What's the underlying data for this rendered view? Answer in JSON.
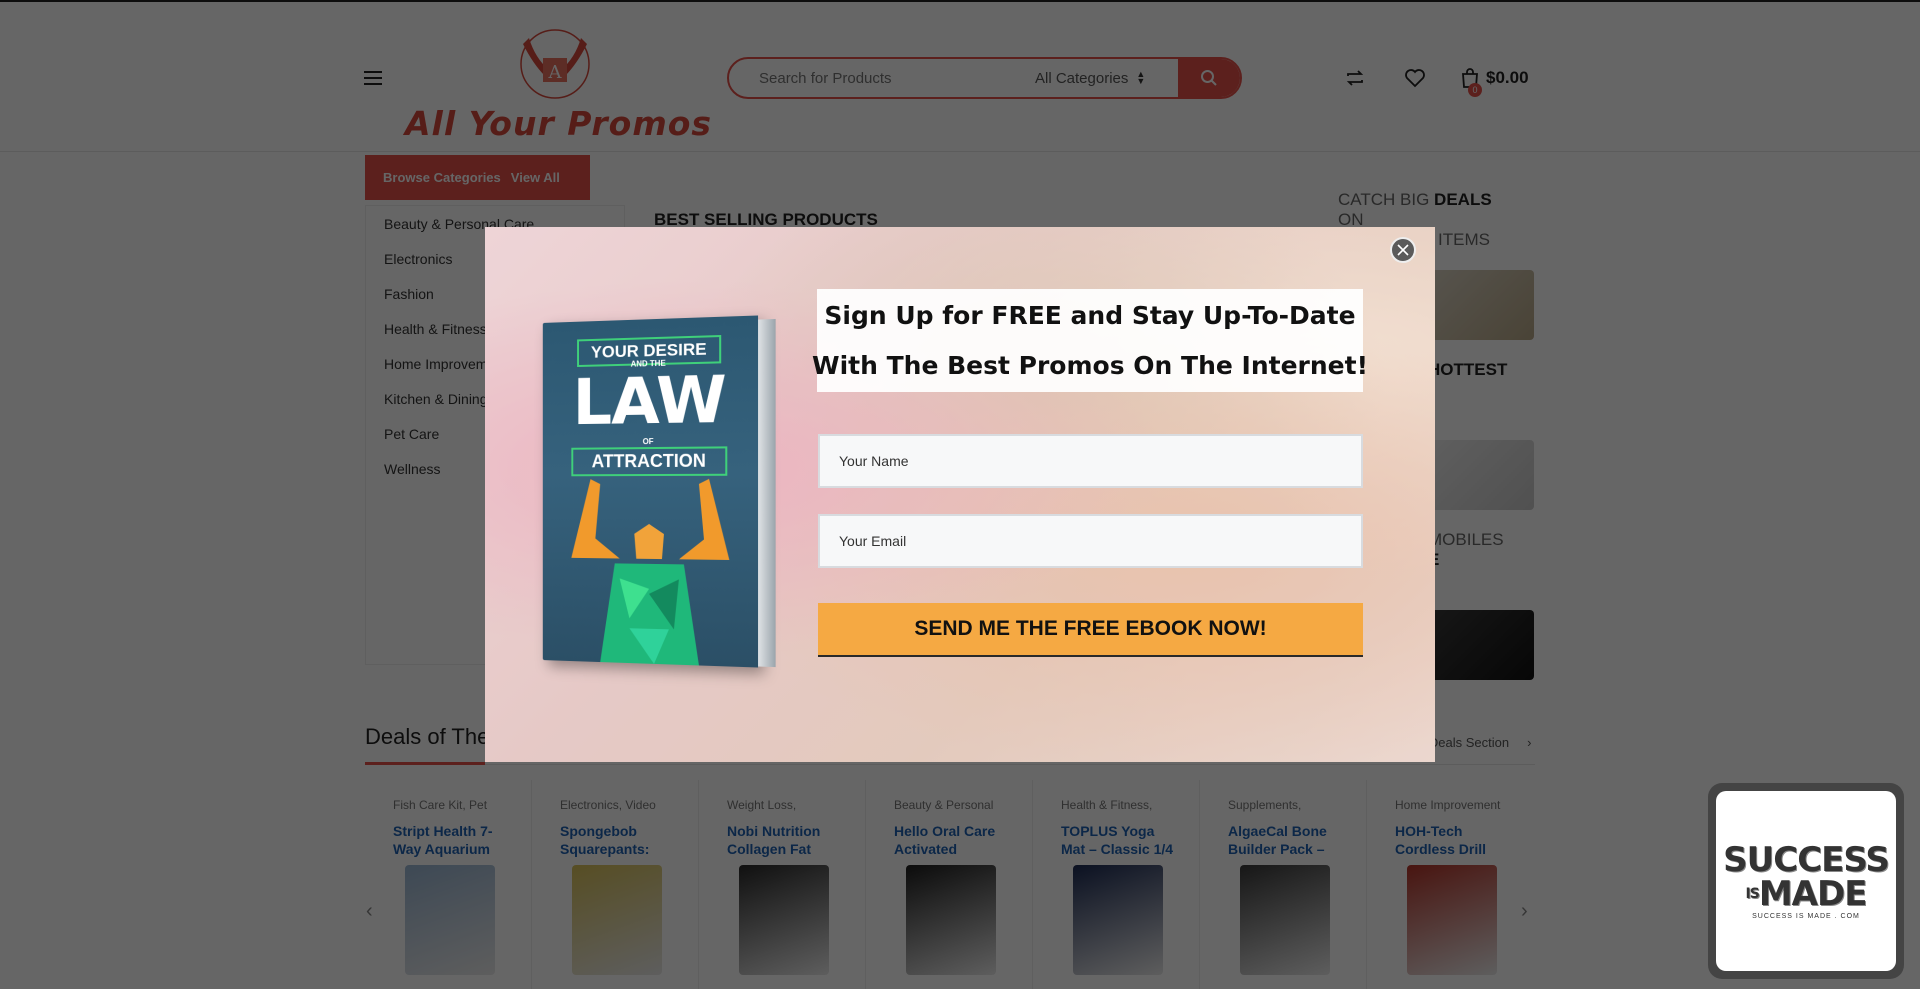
{
  "header": {
    "logo_text": "All Your Promos",
    "logo_letter": "A",
    "search_placeholder": "Search for Products",
    "category_select": "All Categories",
    "cart_count": "0",
    "cart_total": "$0.00"
  },
  "sidebar": {
    "browse_label": "Browse Categories",
    "view_all": "View All",
    "categories": [
      "Beauty & Personal Care",
      "Electronics",
      "Fashion",
      "Health & Fitness",
      "Home Improvement",
      "Kitchen & Dining",
      "Pet Care",
      "Wellness"
    ]
  },
  "main": {
    "best_selling": "BEST SELLING PRODUCTS"
  },
  "side_promos": [
    {
      "line1": "CATCH BIG",
      "bold": "DEALS",
      "line2": "ON",
      "line3": "ITEMS"
    },
    {
      "line1": "",
      "bold": "HOTTEST",
      "line2": "",
      "line3": ""
    },
    {
      "line1": "MOBILES",
      "bold": "E",
      "line2": "",
      "line3": ""
    }
  ],
  "deals": {
    "title": "Deals of The Day",
    "link": "View All Deals Section",
    "products": [
      {
        "category": "Fish Care Kit, Pet",
        "name": "Stript Health 7-Way Aquarium",
        "color": "#9ab6d3"
      },
      {
        "category": "Electronics, Video",
        "name": "Spongebob Squarepants:",
        "color": "#d9c25a"
      },
      {
        "category": "Weight Loss,",
        "name": "Nobi Nutrition Collagen Fat",
        "color": "#2a2a2a"
      },
      {
        "category": "Beauty & Personal",
        "name": "Hello Oral Care Activated",
        "color": "#1e1e1e"
      },
      {
        "category": "Health & Fitness,",
        "name": "TOPLUS Yoga Mat – Classic 1/4",
        "color": "#1d2c55"
      },
      {
        "category": "Supplements,",
        "name": "AlgaeCal Bone Builder Pack –",
        "color": "#3a3a3a"
      },
      {
        "category": "Home Improvement",
        "name": "HOH-Tech Cordless Drill",
        "color": "#b5352a"
      }
    ]
  },
  "modal": {
    "headline_line1": "Sign Up for FREE and Stay Up-To-Date",
    "headline_line2": "With The Best Promos On The Internet!",
    "name_placeholder": "Your Name",
    "email_placeholder": "Your Email",
    "cta_label": "SEND ME THE FREE EBOOK NOW!",
    "ebook": {
      "title_top": "YOUR DESIRE",
      "title_and": "AND THE",
      "title_main": "LAW",
      "title_of": "OF",
      "title_bottom": "ATTRACTION"
    }
  },
  "widget": {
    "line1": "SUCCESS",
    "line2_a": "IS",
    "line2_b": "MADE",
    "line3": "SUCCESS IS MADE . COM"
  },
  "colors": {
    "brand_red": "#e5514a",
    "cta_orange": "#f5a943",
    "link_blue": "#1e63b5"
  }
}
